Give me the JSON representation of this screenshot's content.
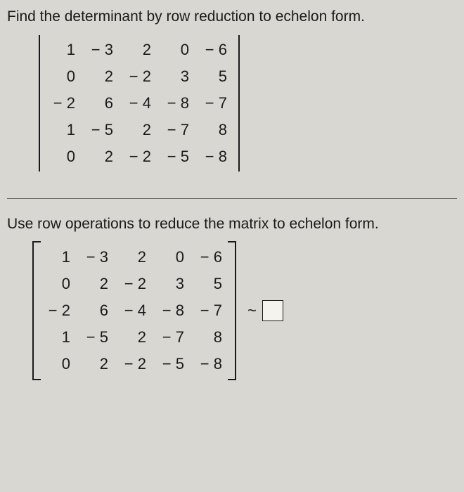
{
  "prompt1": "Find the determinant by row reduction to echelon form.",
  "prompt2": "Use row operations to reduce the matrix to echelon form.",
  "matrix": [
    [
      "1",
      "− 3",
      "2",
      "0",
      "− 6"
    ],
    [
      "0",
      "2",
      "− 2",
      "3",
      "5"
    ],
    [
      "− 2",
      "6",
      "− 4",
      "− 8",
      "− 7"
    ],
    [
      "1",
      "− 5",
      "2",
      "− 7",
      "8"
    ],
    [
      "0",
      "2",
      "− 2",
      "− 5",
      "− 8"
    ]
  ],
  "tilde": "~",
  "answer_value": ""
}
